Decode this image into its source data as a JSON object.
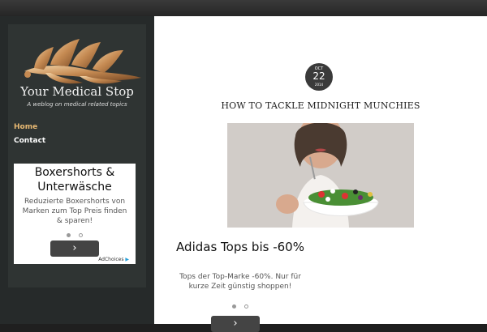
{
  "site": {
    "title": "Your Medical Stop",
    "tagline": "A weblog on medical related topics"
  },
  "nav": {
    "items": [
      {
        "label": "Home",
        "active": true
      },
      {
        "label": "Contact",
        "active": false
      }
    ]
  },
  "sidebar_ad": {
    "title": "Boxershorts & Unterwäsche",
    "text": "Reduzierte Boxershorts von Marken zum Top Preis finden & sparen!",
    "button_icon": "chevron-right-icon",
    "adchoices_label": "AdChoices"
  },
  "post": {
    "date": {
      "month": "OCT",
      "day": "22",
      "year": "2014"
    },
    "title": "HOW TO TACKLE MIDNIGHT MUNCHIES"
  },
  "content_ad": {
    "title": "Adidas Tops bis -60%",
    "text": "Tops der Top-Marke -60%. Nur für kurze Zeit günstig shoppen!",
    "button_icon": "chevron-right-icon"
  },
  "colors": {
    "background": "#1f1f1f",
    "sidebar": "#2f3433",
    "nav_active": "#e8b973",
    "main_bg": "#ffffff"
  }
}
